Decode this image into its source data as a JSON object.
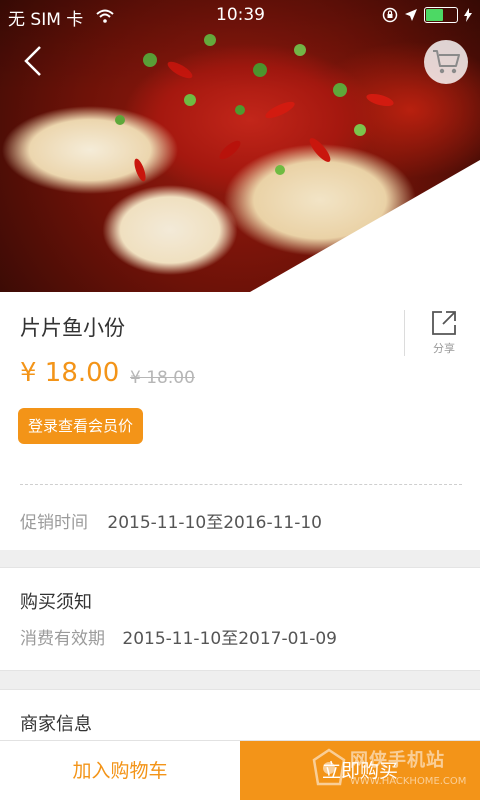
{
  "status_bar": {
    "carrier": "无 SIM 卡",
    "time": "10:39"
  },
  "product": {
    "name": "片片鱼小份",
    "price": "¥ 18.00",
    "original_price": "¥ 18.00",
    "member_price_button": "登录查看会员价",
    "share_label": "分享",
    "promo_label": "促销时间",
    "promo_value": "2015-11-10至2016-11-10"
  },
  "notice": {
    "title": "购买须知",
    "validity_label": "消费有效期",
    "validity_value": "2015-11-10至2017-01-09"
  },
  "merchant": {
    "title": "商家信息"
  },
  "bottom_bar": {
    "add_to_cart": "加入购物车",
    "buy_now": "立即购买"
  },
  "watermark": {
    "text": "网侠手机站",
    "url": "WWW.HACKHOME.COM"
  },
  "colors": {
    "accent": "#f39418",
    "battery": "#4cd964"
  },
  "battery_level": 0.6
}
